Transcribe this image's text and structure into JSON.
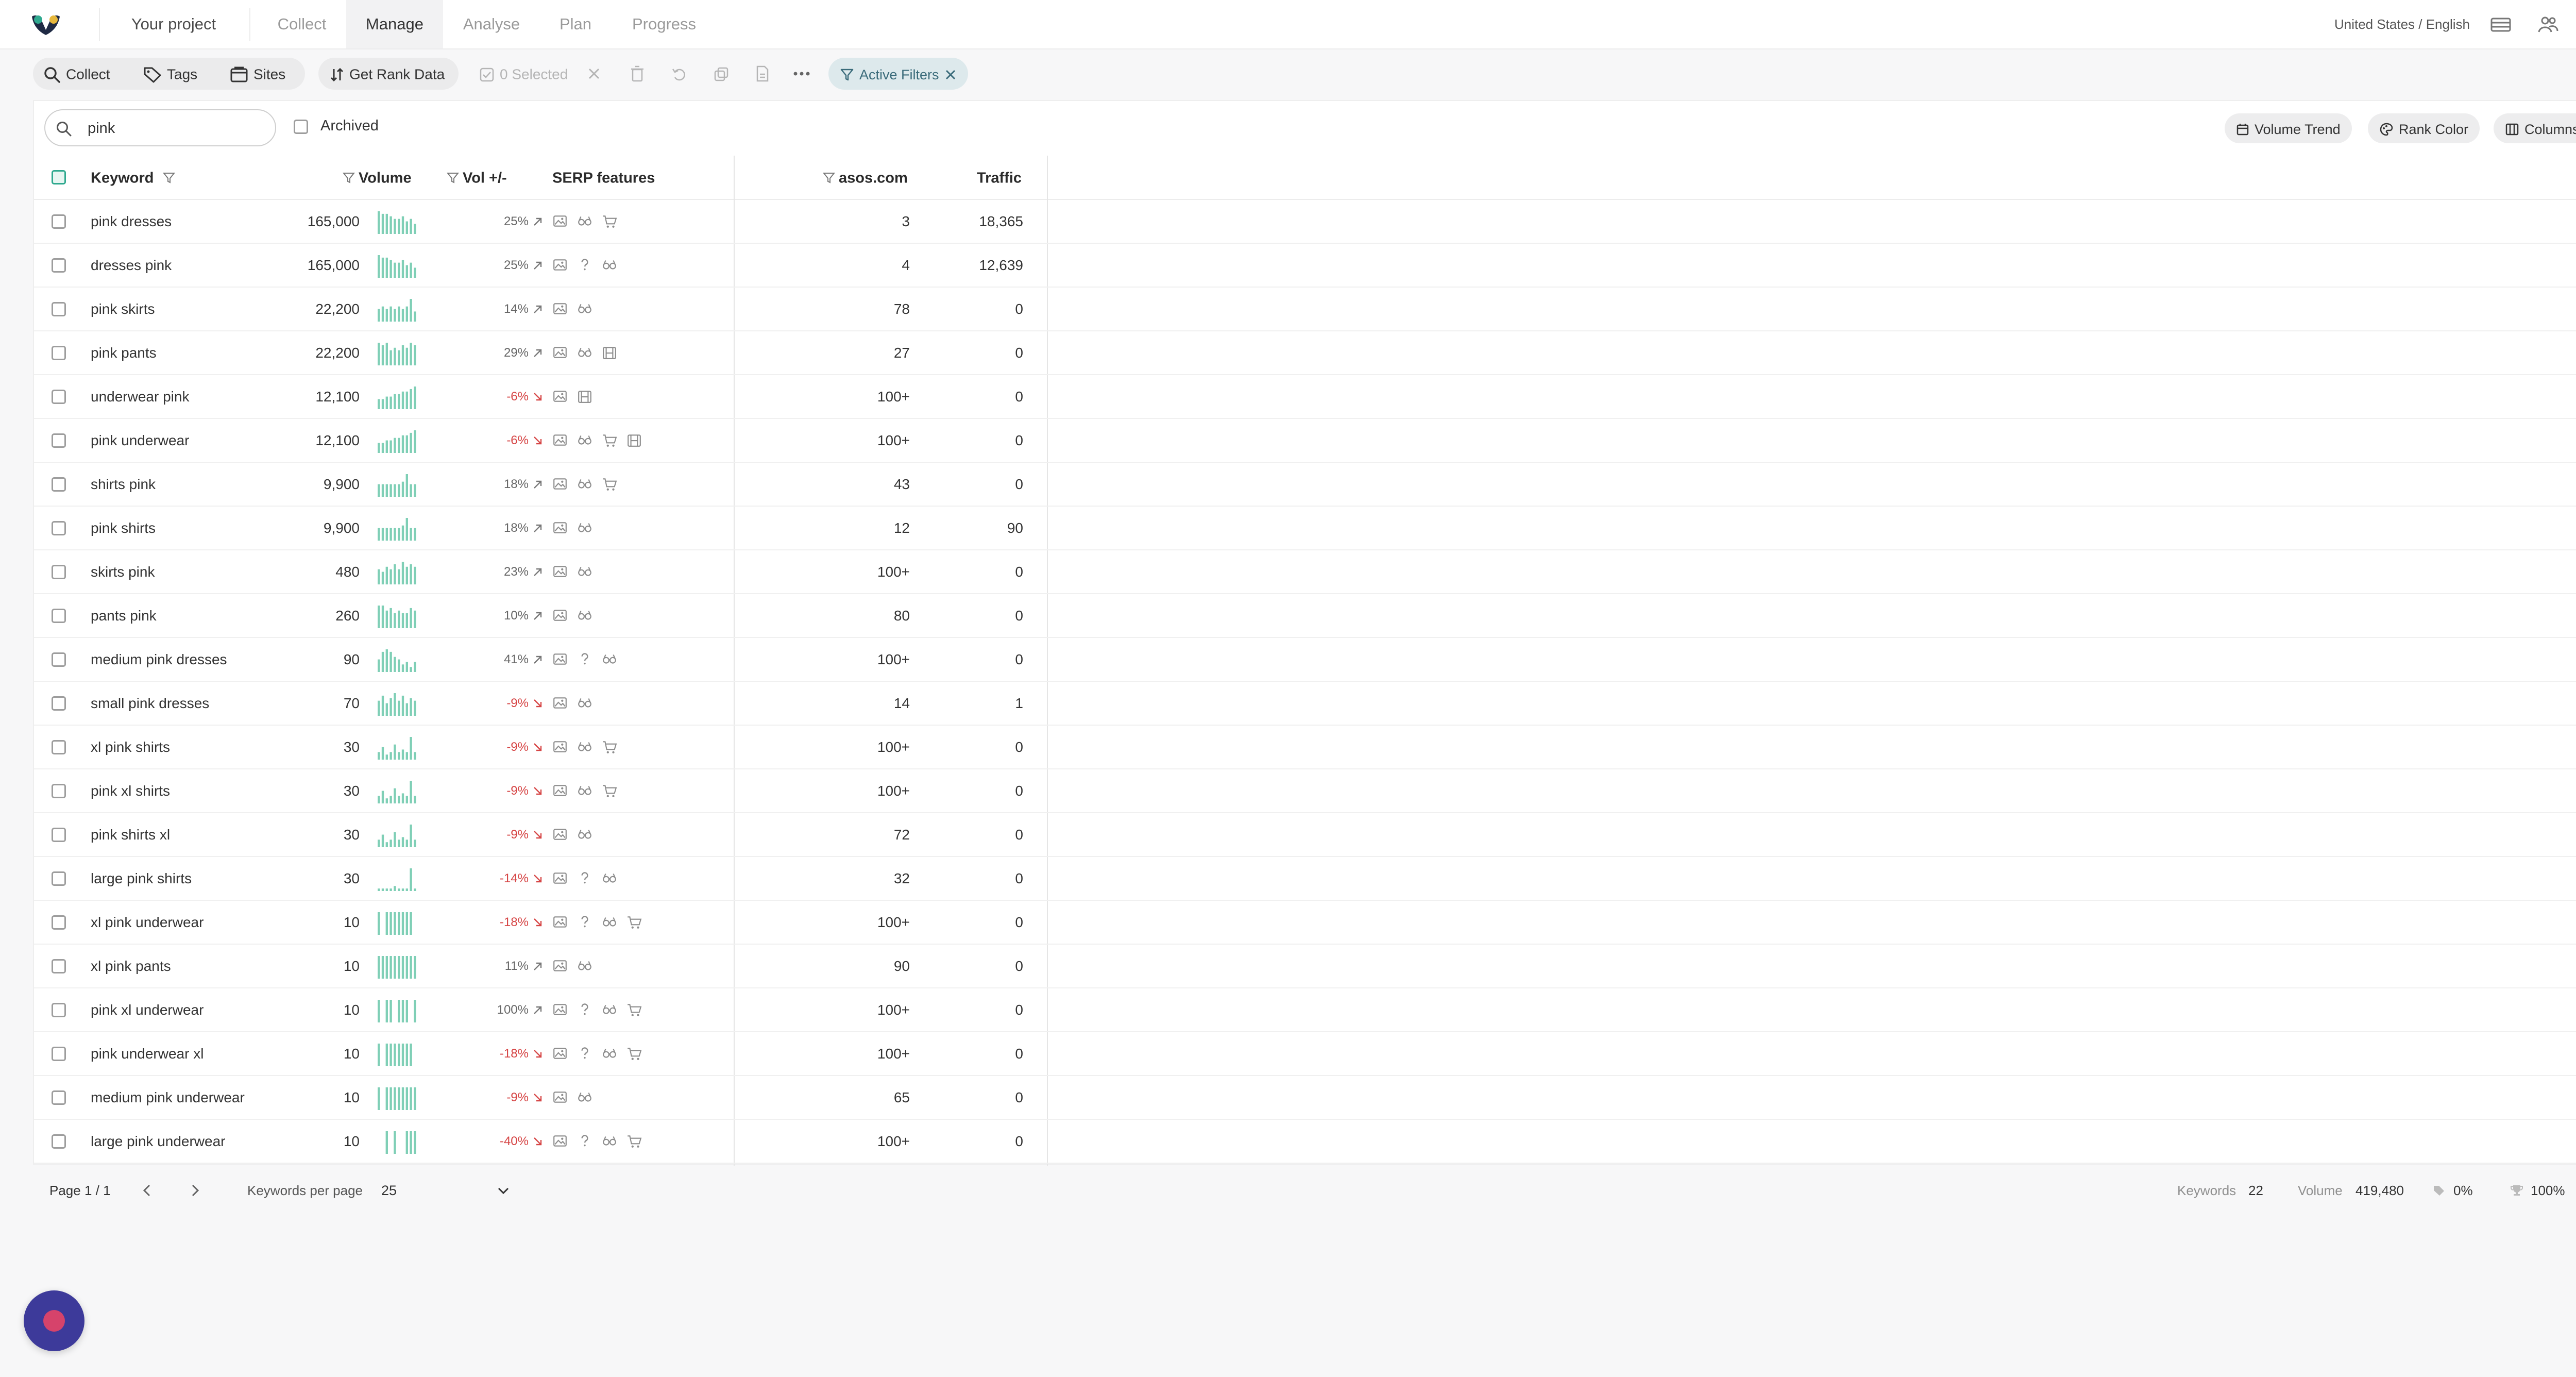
{
  "nav": {
    "project": "Your project",
    "tabs": [
      "Collect",
      "Manage",
      "Analyse",
      "Plan",
      "Progress"
    ],
    "active_tab": "Manage",
    "locale": "United States / English"
  },
  "toolbar": {
    "collect": "Collect",
    "tags": "Tags",
    "sites": "Sites",
    "get_rank_data": "Get Rank Data",
    "selected": "0 Selected",
    "active_filters": "Active Filters"
  },
  "search": {
    "value": "pink"
  },
  "archived_label": "Archived",
  "chips": {
    "volume_trend": "Volume Trend",
    "rank_color": "Rank Color",
    "columns": "Columns"
  },
  "columns": {
    "keyword": "Keyword",
    "volume": "Volume",
    "vol_change": "Vol +/-",
    "serp": "SERP features",
    "site": "asos.com",
    "traffic": "Traffic"
  },
  "rows": [
    {
      "keyword": "pink dresses",
      "volume": "165,000",
      "pct": "25%",
      "up": true,
      "serp": [
        "image",
        "glasses",
        "cart"
      ],
      "rank": "3",
      "traffic": "18,365",
      "trend": [
        9,
        8,
        8,
        7,
        6,
        6,
        7,
        5,
        6,
        4
      ]
    },
    {
      "keyword": "dresses pink",
      "volume": "165,000",
      "pct": "25%",
      "up": true,
      "serp": [
        "image",
        "question",
        "glasses"
      ],
      "rank": "4",
      "traffic": "12,639",
      "trend": [
        9,
        8,
        8,
        7,
        6,
        6,
        7,
        5,
        6,
        4
      ]
    },
    {
      "keyword": "pink skirts",
      "volume": "22,200",
      "pct": "14%",
      "up": true,
      "serp": [
        "image",
        "glasses"
      ],
      "rank": "78",
      "traffic": "0",
      "trend": [
        5,
        6,
        5,
        6,
        5,
        6,
        5,
        6,
        9,
        4
      ]
    },
    {
      "keyword": "pink pants",
      "volume": "22,200",
      "pct": "29%",
      "up": true,
      "serp": [
        "image",
        "glasses",
        "film"
      ],
      "rank": "27",
      "traffic": "0",
      "trend": [
        9,
        8,
        9,
        6,
        7,
        6,
        8,
        7,
        9,
        8
      ]
    },
    {
      "keyword": "underwear pink",
      "volume": "12,100",
      "pct": "-6%",
      "up": false,
      "serp": [
        "image",
        "film"
      ],
      "rank": "100+",
      "traffic": "0",
      "trend": [
        4,
        4,
        5,
        5,
        6,
        6,
        7,
        7,
        8,
        9
      ]
    },
    {
      "keyword": "pink underwear",
      "volume": "12,100",
      "pct": "-6%",
      "up": false,
      "serp": [
        "image",
        "glasses",
        "cart",
        "film"
      ],
      "rank": "100+",
      "traffic": "0",
      "trend": [
        4,
        4,
        5,
        5,
        6,
        6,
        7,
        7,
        8,
        9
      ]
    },
    {
      "keyword": "shirts pink",
      "volume": "9,900",
      "pct": "18%",
      "up": true,
      "serp": [
        "image",
        "glasses",
        "cart"
      ],
      "rank": "43",
      "traffic": "0",
      "trend": [
        5,
        5,
        5,
        5,
        5,
        5,
        6,
        9,
        5,
        5
      ]
    },
    {
      "keyword": "pink shirts",
      "volume": "9,900",
      "pct": "18%",
      "up": true,
      "serp": [
        "image",
        "glasses"
      ],
      "rank": "12",
      "traffic": "90",
      "trend": [
        5,
        5,
        5,
        5,
        5,
        5,
        6,
        9,
        5,
        5
      ]
    },
    {
      "keyword": "skirts pink",
      "volume": "480",
      "pct": "23%",
      "up": true,
      "serp": [
        "image",
        "glasses"
      ],
      "rank": "100+",
      "traffic": "0",
      "trend": [
        6,
        5,
        7,
        6,
        8,
        6,
        9,
        7,
        8,
        7
      ]
    },
    {
      "keyword": "pants pink",
      "volume": "260",
      "pct": "10%",
      "up": true,
      "serp": [
        "image",
        "glasses"
      ],
      "rank": "80",
      "traffic": "0",
      "trend": [
        9,
        9,
        7,
        8,
        6,
        7,
        6,
        6,
        8,
        7
      ]
    },
    {
      "keyword": "medium pink dresses",
      "volume": "90",
      "pct": "41%",
      "up": true,
      "serp": [
        "image",
        "question",
        "glasses"
      ],
      "rank": "100+",
      "traffic": "0",
      "trend": [
        5,
        8,
        9,
        8,
        6,
        5,
        3,
        4,
        2,
        4
      ]
    },
    {
      "keyword": "small pink dresses",
      "volume": "70",
      "pct": "-9%",
      "up": false,
      "serp": [
        "image",
        "glasses"
      ],
      "rank": "14",
      "traffic": "1",
      "trend": [
        6,
        8,
        5,
        7,
        9,
        6,
        8,
        5,
        7,
        6
      ]
    },
    {
      "keyword": "xl pink shirts",
      "volume": "30",
      "pct": "-9%",
      "up": false,
      "serp": [
        "image",
        "glasses",
        "cart"
      ],
      "rank": "100+",
      "traffic": "0",
      "trend": [
        3,
        5,
        2,
        3,
        6,
        3,
        4,
        3,
        9,
        3
      ]
    },
    {
      "keyword": "pink xl shirts",
      "volume": "30",
      "pct": "-9%",
      "up": false,
      "serp": [
        "image",
        "glasses",
        "cart"
      ],
      "rank": "100+",
      "traffic": "0",
      "trend": [
        3,
        5,
        2,
        3,
        6,
        3,
        4,
        3,
        9,
        3
      ]
    },
    {
      "keyword": "pink shirts xl",
      "volume": "30",
      "pct": "-9%",
      "up": false,
      "serp": [
        "image",
        "glasses"
      ],
      "rank": "72",
      "traffic": "0",
      "trend": [
        3,
        5,
        2,
        3,
        6,
        3,
        4,
        3,
        9,
        3
      ]
    },
    {
      "keyword": "large pink shirts",
      "volume": "30",
      "pct": "-14%",
      "up": false,
      "serp": [
        "image",
        "question",
        "glasses"
      ],
      "rank": "32",
      "traffic": "0",
      "trend": [
        1,
        1,
        1,
        1,
        2,
        1,
        1,
        1,
        9,
        1
      ]
    },
    {
      "keyword": "xl pink underwear",
      "volume": "10",
      "pct": "-18%",
      "up": false,
      "serp": [
        "image",
        "question",
        "glasses",
        "cart"
      ],
      "rank": "100+",
      "traffic": "0",
      "trend": [
        9,
        0,
        9,
        9,
        9,
        9,
        9,
        9,
        9,
        0
      ]
    },
    {
      "keyword": "xl pink pants",
      "volume": "10",
      "pct": "11%",
      "up": true,
      "serp": [
        "image",
        "glasses"
      ],
      "rank": "90",
      "traffic": "0",
      "trend": [
        9,
        9,
        9,
        9,
        9,
        9,
        9,
        9,
        9,
        9
      ]
    },
    {
      "keyword": "pink xl underwear",
      "volume": "10",
      "pct": "100%",
      "up": true,
      "serp": [
        "image",
        "question",
        "glasses",
        "cart"
      ],
      "rank": "100+",
      "traffic": "0",
      "trend": [
        9,
        0,
        9,
        9,
        0,
        9,
        9,
        9,
        0,
        9
      ]
    },
    {
      "keyword": "pink underwear xl",
      "volume": "10",
      "pct": "-18%",
      "up": false,
      "serp": [
        "image",
        "question",
        "glasses",
        "cart"
      ],
      "rank": "100+",
      "traffic": "0",
      "trend": [
        9,
        0,
        9,
        9,
        9,
        9,
        9,
        9,
        9,
        0
      ]
    },
    {
      "keyword": "medium pink underwear",
      "volume": "10",
      "pct": "-9%",
      "up": false,
      "serp": [
        "image",
        "glasses"
      ],
      "rank": "65",
      "traffic": "0",
      "trend": [
        9,
        0,
        9,
        9,
        9,
        9,
        9,
        9,
        9,
        9
      ]
    },
    {
      "keyword": "large pink underwear",
      "volume": "10",
      "pct": "-40%",
      "up": false,
      "serp": [
        "image",
        "question",
        "glasses",
        "cart"
      ],
      "rank": "100+",
      "traffic": "0",
      "trend": [
        0,
        0,
        9,
        0,
        9,
        0,
        0,
        9,
        9,
        9
      ]
    }
  ],
  "footer": {
    "page": "Page 1 / 1",
    "per_page_label": "Keywords per page",
    "per_page_value": "25",
    "keywords_label": "Keywords",
    "keywords_value": "22",
    "volume_label": "Volume",
    "volume_value": "419,480",
    "tag_pct": "0%",
    "rank_pct": "100%"
  },
  "colors": {
    "accent": "#2fa98f",
    "spark": "#7fcfb6",
    "negative": "#d64545",
    "filter_bg": "#dde9ec",
    "help_bubble": "#3d3a9a"
  }
}
